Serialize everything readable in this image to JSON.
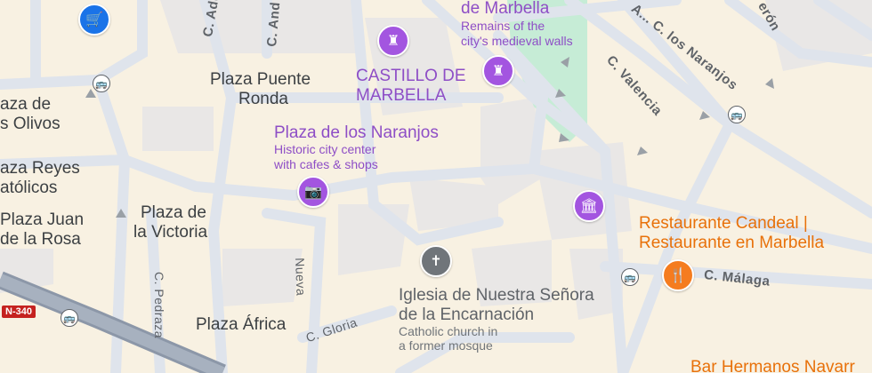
{
  "colors": {
    "land": "#f8f1e2",
    "road": "#dfe4ec",
    "road_edge": "#c9d2de",
    "block": "#e9e7e6",
    "park": "#c6ecd6",
    "highway": "#8c97a8",
    "poi_purple": "#a355e0",
    "restaurant_orange": "#f57c1f",
    "shopping_blue": "#1a73e8"
  },
  "labels": {
    "de_marbella": "de Marbella",
    "remains_line1": "Remains of the",
    "remains_line2": "city's medieval walls",
    "castillo_line1": "CASTILLO DE",
    "castillo_line2": "MARBELLA",
    "plaza_puente_line1": "Plaza Puente",
    "plaza_puente_line2": "Ronda",
    "naranjos_title": "Plaza de los Naranjos",
    "naranjos_sub1": "Historic city center",
    "naranjos_sub2": "with cafes & shops",
    "olivos_line1": "aza de",
    "olivos_line2": "s Olivos",
    "reyes_line1": "aza Reyes",
    "reyes_line2": "atólicos",
    "juan_line1": "Plaza Juan",
    "juan_line2": "de la Rosa",
    "victoria_line1": "Plaza de",
    "victoria_line2": "la Victoria",
    "africa": "Plaza África",
    "iglesia_line1": "Iglesia de Nuestra Señora",
    "iglesia_line2": "de la Encarnación",
    "iglesia_sub1": "Catholic church in",
    "iglesia_sub2": "a former mosque",
    "candeal_line1": "Restaurante Candeal |",
    "candeal_line2": "Restaurante en Marbella",
    "bar": "Bar Hermanos Navarr",
    "street_aduar": "C. Aduar",
    "street_ancha": "C. And",
    "street_naranjos": "A... C. los Naranjos",
    "street_valencia": "C. Valencia",
    "street_malaga": "C. Málaga",
    "street_gloria": "C. Gloria",
    "street_nueva": "Nueva",
    "street_pedraza": "C. Pedraza",
    "street_eron": "erón",
    "road_shield": "N-340"
  },
  "icons": {
    "shopping": "shopping-cart-icon",
    "castle": "castle-icon",
    "camera": "camera-icon",
    "museum": "museum-icon",
    "church": "cross-icon",
    "restaurant": "fork-knife-icon",
    "bus": "bus-stop-icon"
  }
}
